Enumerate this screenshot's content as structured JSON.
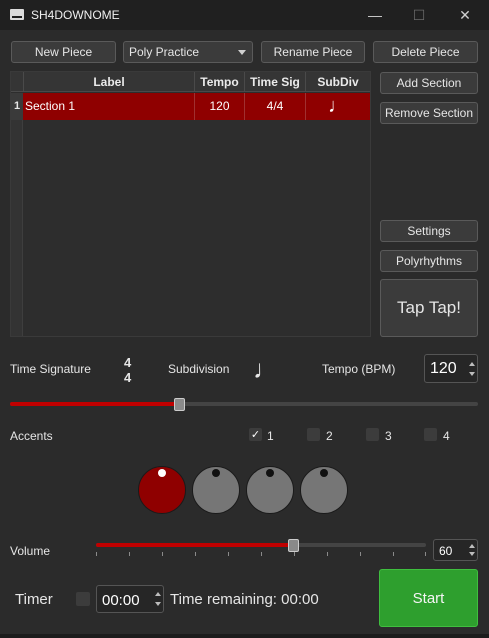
{
  "window": {
    "title": "SH4DOWNOME",
    "minimize": "—",
    "maximize": "☐",
    "close": "✕"
  },
  "toolbar": {
    "new_piece": "New Piece",
    "piece_select": "Poly Practice",
    "rename_piece": "Rename Piece",
    "delete_piece": "Delete Piece"
  },
  "table": {
    "columns": [
      "Label",
      "Tempo",
      "Time Sig",
      "SubDiv"
    ],
    "rows": [
      {
        "index": "1",
        "label": "Section 1",
        "tempo": "120",
        "time_sig": "4/4",
        "subdiv": "♩"
      }
    ]
  },
  "side": {
    "add_section": "Add Section",
    "remove_section": "Remove Section",
    "settings": "Settings",
    "polyrhythms": "Polyrhythms",
    "tap": "Tap Tap!"
  },
  "controls": {
    "time_signature_label": "Time Signature",
    "ts_top": "4",
    "ts_bottom": "4",
    "subdivision_label": "Subdivision",
    "subdivision_icon": "♩",
    "tempo_label": "Tempo (BPM)",
    "tempo_value": "120",
    "tempo_slider_fraction": 0.36
  },
  "accents": {
    "label": "Accents",
    "items": [
      {
        "num": "1",
        "checked": true
      },
      {
        "num": "2",
        "checked": false
      },
      {
        "num": "3",
        "checked": false
      },
      {
        "num": "4",
        "checked": false
      }
    ],
    "active_color": "#8f0000",
    "inactive_color": "#767676"
  },
  "volume": {
    "label": "Volume",
    "value": "60",
    "fraction": 0.6
  },
  "timer": {
    "label": "Timer",
    "value": "00:00",
    "remaining": "Time remaining: 00:00",
    "start": "Start"
  }
}
